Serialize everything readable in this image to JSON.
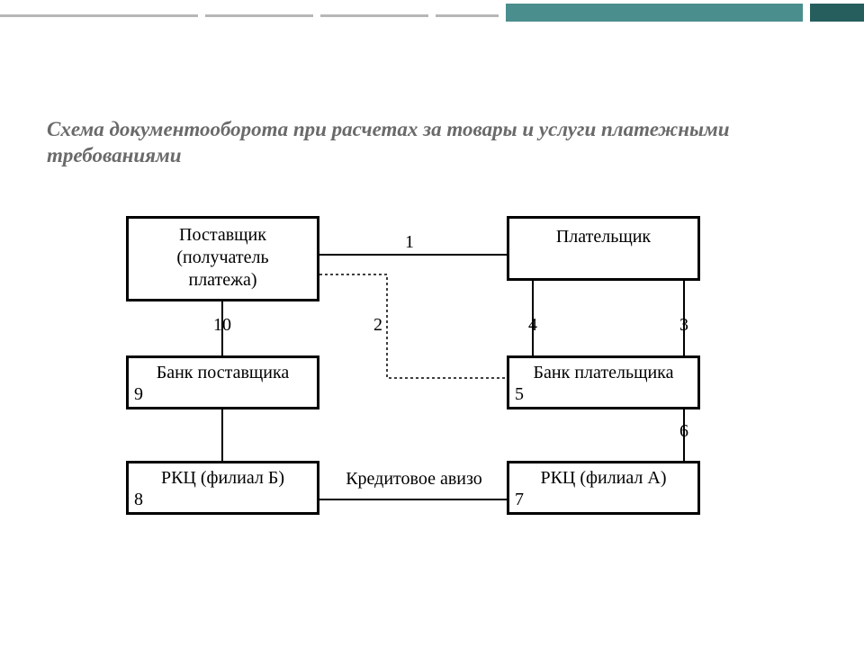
{
  "title": "Схема документооборота при расчетах за товары и услуги платежными требованиями",
  "boxes": {
    "supplier": {
      "line1": "Поставщик",
      "line2": "(получатель",
      "line3": "платежа)"
    },
    "payer": {
      "line1": "Плательщик"
    },
    "bankSupplier": {
      "line1": "Банк поставщика",
      "corner9": "9"
    },
    "bankPayer": {
      "line1": "Банк плательщика",
      "corner5": "5"
    },
    "rkcB": {
      "line1": "РКЦ (филиал Б)",
      "corner8": "8"
    },
    "rkcA": {
      "line1": "РКЦ (филиал А)",
      "corner7": "7"
    }
  },
  "labels": {
    "l1": "1",
    "l2": "2",
    "l3": "3",
    "l4": "4",
    "l6": "6",
    "l10": "10",
    "credit": "Кредитовое авизо"
  }
}
